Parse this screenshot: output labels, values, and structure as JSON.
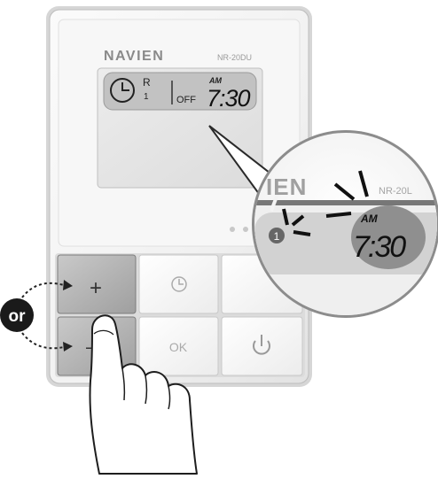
{
  "device": {
    "brand": "NAVIEN",
    "model": "NR-20DU"
  },
  "display": {
    "mode": "R",
    "slot": "1",
    "status": "OFF",
    "ampm": "AM",
    "time": "7:30"
  },
  "buttons": {
    "plus": "+",
    "minus": "—",
    "ok": "OK"
  },
  "callout": {
    "brand_partial": "IEN",
    "model_partial": "NR-20L",
    "slot": "1",
    "ampm": "AM",
    "time": "7:30"
  },
  "hint": {
    "or_label": "or"
  },
  "icons": [
    "clock-icon",
    "power-icon",
    "hand-pointer-icon",
    "dotted-arrow-icon"
  ]
}
